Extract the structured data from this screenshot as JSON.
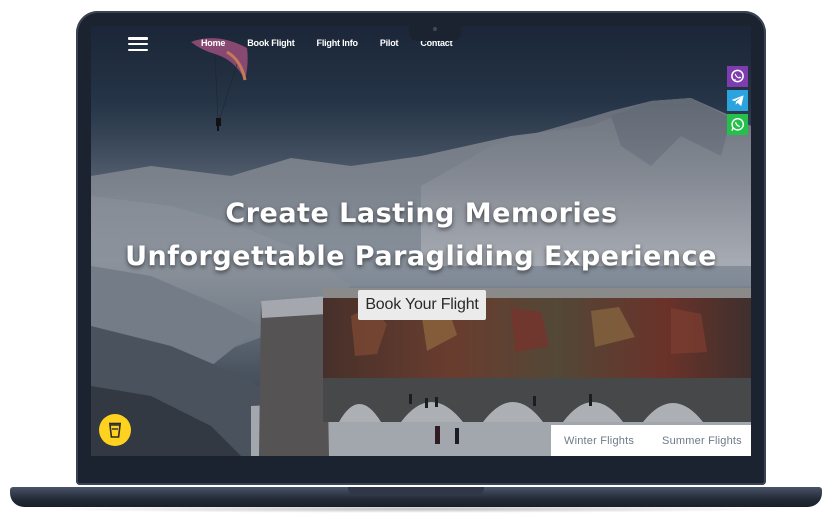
{
  "nav": {
    "items": [
      {
        "label": "Home"
      },
      {
        "label": "Book Flight"
      },
      {
        "label": "Flight Info"
      },
      {
        "label": "Pilot"
      },
      {
        "label": "Contact"
      }
    ]
  },
  "hero": {
    "line1": "Create Lasting Memories",
    "line2": "Unforgettable Paragliding Experience",
    "cta_label": "Book Your Flight"
  },
  "tabs": {
    "items": [
      {
        "label": "Winter Flights"
      },
      {
        "label": "Summer Flights"
      }
    ]
  },
  "social": {
    "icons": [
      "viber-icon",
      "telegram-icon",
      "whatsapp-icon"
    ]
  },
  "colors": {
    "viber": "#7d3daf",
    "telegram": "#2aa3df",
    "whatsapp": "#25c04b",
    "cup_button": "#ffd21f",
    "laptop_frame": "#1c2330"
  }
}
